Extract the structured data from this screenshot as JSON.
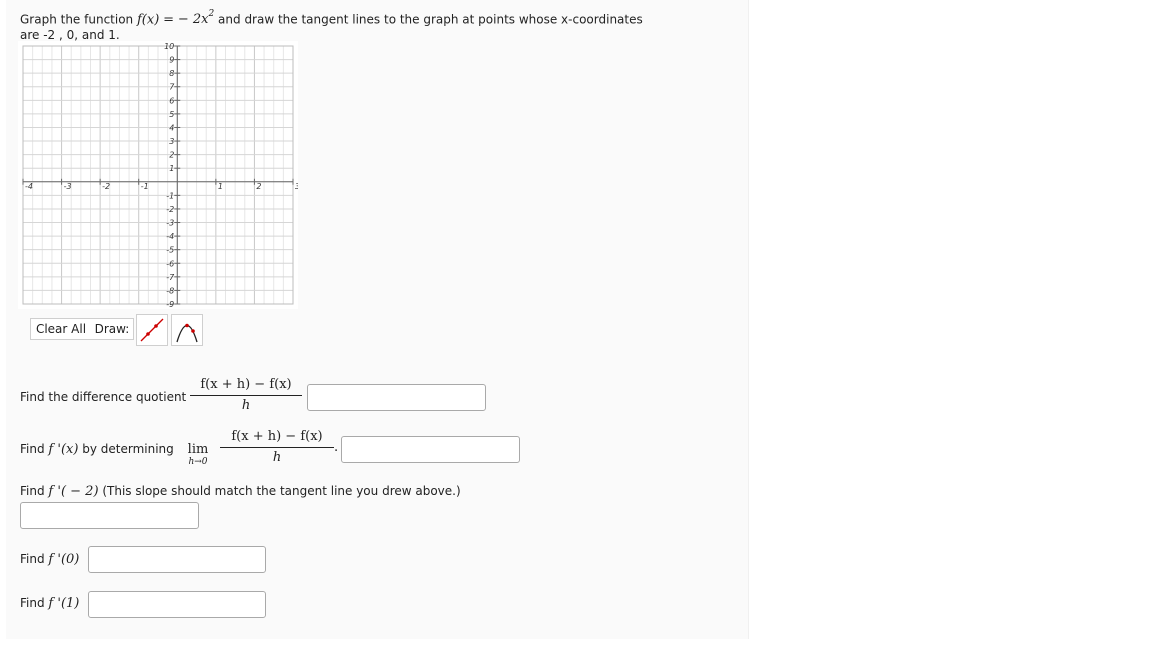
{
  "problem": {
    "intro_prefix": "Graph the function",
    "func_lhs": "f(x)",
    "equals": "=",
    "func_rhs": "− 2x",
    "exponent": "2",
    "intro_suffix": "and draw the tangent lines to the graph at points whose x-coordinates",
    "intro_line2": "are -2 , 0, and 1."
  },
  "graph": {
    "x_ticks": [
      "-4",
      "-3",
      "-2",
      "-1",
      "1",
      "2",
      "3"
    ],
    "y_ticks": [
      "10",
      "9",
      "8",
      "7",
      "6",
      "5",
      "4",
      "3",
      "2",
      "1",
      "-1",
      "-2",
      "-3",
      "-4",
      "-5",
      "-6",
      "-7",
      "-8",
      "-9"
    ],
    "x_range": [
      -4,
      3
    ],
    "y_range": [
      -9,
      10
    ],
    "grid": true,
    "grid_color": "#d8d8d8",
    "axis_color": "#666666"
  },
  "toolbar": {
    "clear_label": "Clear All",
    "draw_label": "Draw:",
    "line_tool_icon": "line-segment-icon",
    "parabola_tool_icon": "parabola-icon",
    "accent": "#cc0000"
  },
  "questions": {
    "q1_label": "Find the difference quotient",
    "dq_numerator": "f(x + h) − f(x)",
    "dq_denominator": "h",
    "q2_label_prefix": "Find",
    "q2_fprime": "f '(x)",
    "q2_label_mid": "by determining",
    "q2_lim": "lim",
    "q2_lim_sub": "h→0",
    "q2_period": ".",
    "q3_prefix": "Find",
    "q3_expr": "f '( − 2)",
    "q3_suffix": "(This slope should match the tangent line you drew above.)",
    "q4_prefix": "Find",
    "q4_expr": "f '(0)",
    "q5_prefix": "Find",
    "q5_expr": "f '(1)"
  },
  "answers": {
    "dq_value": "",
    "fprime_value": "",
    "fprime_m2_value": "",
    "fprime_0_value": "",
    "fprime_1_value": ""
  }
}
